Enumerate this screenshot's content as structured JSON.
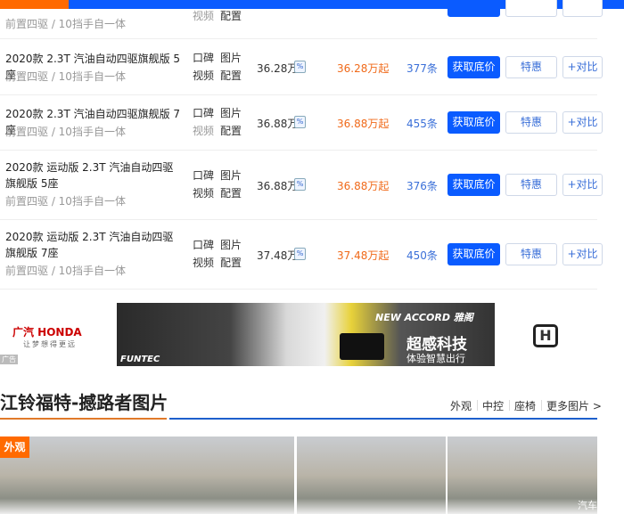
{
  "top_row": {
    "sub": "前置四驱 / 10挡手自一体",
    "links": [
      "视频",
      "配置"
    ]
  },
  "rows": [
    {
      "name": "2020款 2.3T 汽油自动四驱旗舰版 5座",
      "sub": "前置四驱 / 10挡手自一体",
      "guide": "36.28万",
      "low": "36.28万起",
      "count": "377条"
    },
    {
      "name": "2020款 2.3T 汽油自动四驱旗舰版 7座",
      "sub": "前置四驱 / 10挡手自一体",
      "guide": "36.88万",
      "low": "36.88万起",
      "count": "455条"
    },
    {
      "name": "2020款 运动版 2.3T 汽油自动四驱旗舰版 5座",
      "sub": "前置四驱 / 10挡手自一体",
      "guide": "36.88万",
      "low": "36.88万起",
      "count": "376条"
    },
    {
      "name": "2020款 运动版 2.3T 汽油自动四驱旗舰版 7座",
      "sub": "前置四驱 / 10挡手自一体",
      "guide": "37.48万",
      "low": "37.48万起",
      "count": "450条"
    }
  ],
  "row_links": {
    "koubei": "口碑",
    "tupian": "图片",
    "shipin": "视频",
    "peizhi": "配置"
  },
  "buttons": {
    "price": "获取底价",
    "deal": "特惠",
    "compare": "+对比"
  },
  "calc_icon": "%",
  "ad": {
    "brand": "广汽 HONDA",
    "slogan": "让梦想得更远",
    "label": "广告",
    "banner_model": "NEW ACCORD 雅阁",
    "banner_head": "超感科技",
    "banner_sub": "体验智慧出行",
    "banner_tag": "FUNTEC"
  },
  "section": {
    "title": "江铃福特-撼路者图片",
    "links": [
      "外观",
      "中控",
      "座椅",
      "更多图片 >"
    ],
    "badge": "外观",
    "watermark": "汽车"
  },
  "colors": {
    "accent": "#0a5bff",
    "orange": "#ff6a00"
  }
}
